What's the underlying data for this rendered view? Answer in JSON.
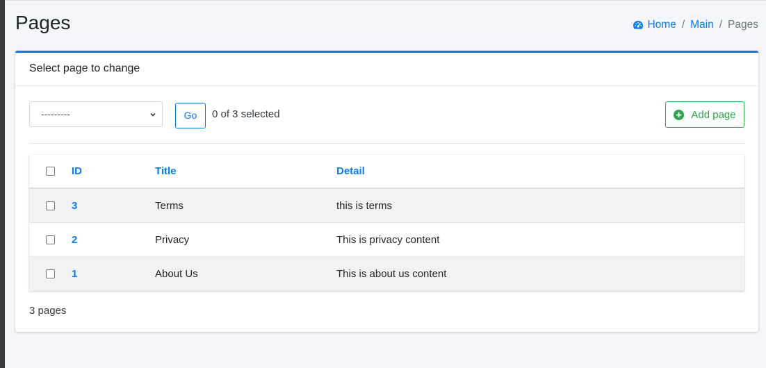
{
  "page": {
    "title": "Pages"
  },
  "breadcrumb": {
    "home": "Home",
    "main": "Main",
    "current": "Pages",
    "sep": "/"
  },
  "card": {
    "header": "Select page to change"
  },
  "actions": {
    "select_value": "---------",
    "go_label": "Go",
    "selected_text": "0 of 3 selected",
    "add_label": "Add page"
  },
  "table": {
    "headers": {
      "id": "ID",
      "title": "Title",
      "detail": "Detail"
    },
    "rows": [
      {
        "id": "3",
        "title": "Terms",
        "detail": "this is terms"
      },
      {
        "id": "2",
        "title": "Privacy",
        "detail": "This is privacy content"
      },
      {
        "id": "1",
        "title": "About Us",
        "detail": "This is about us content"
      }
    ]
  },
  "footer": {
    "count": "3 pages"
  },
  "colors": {
    "primary": "#007bff",
    "success": "#28a745",
    "sidebar": "#343a40"
  },
  "icons": {
    "home": "tachometer-icon",
    "add": "plus-circle-icon",
    "select": "chevron-down-icon"
  }
}
